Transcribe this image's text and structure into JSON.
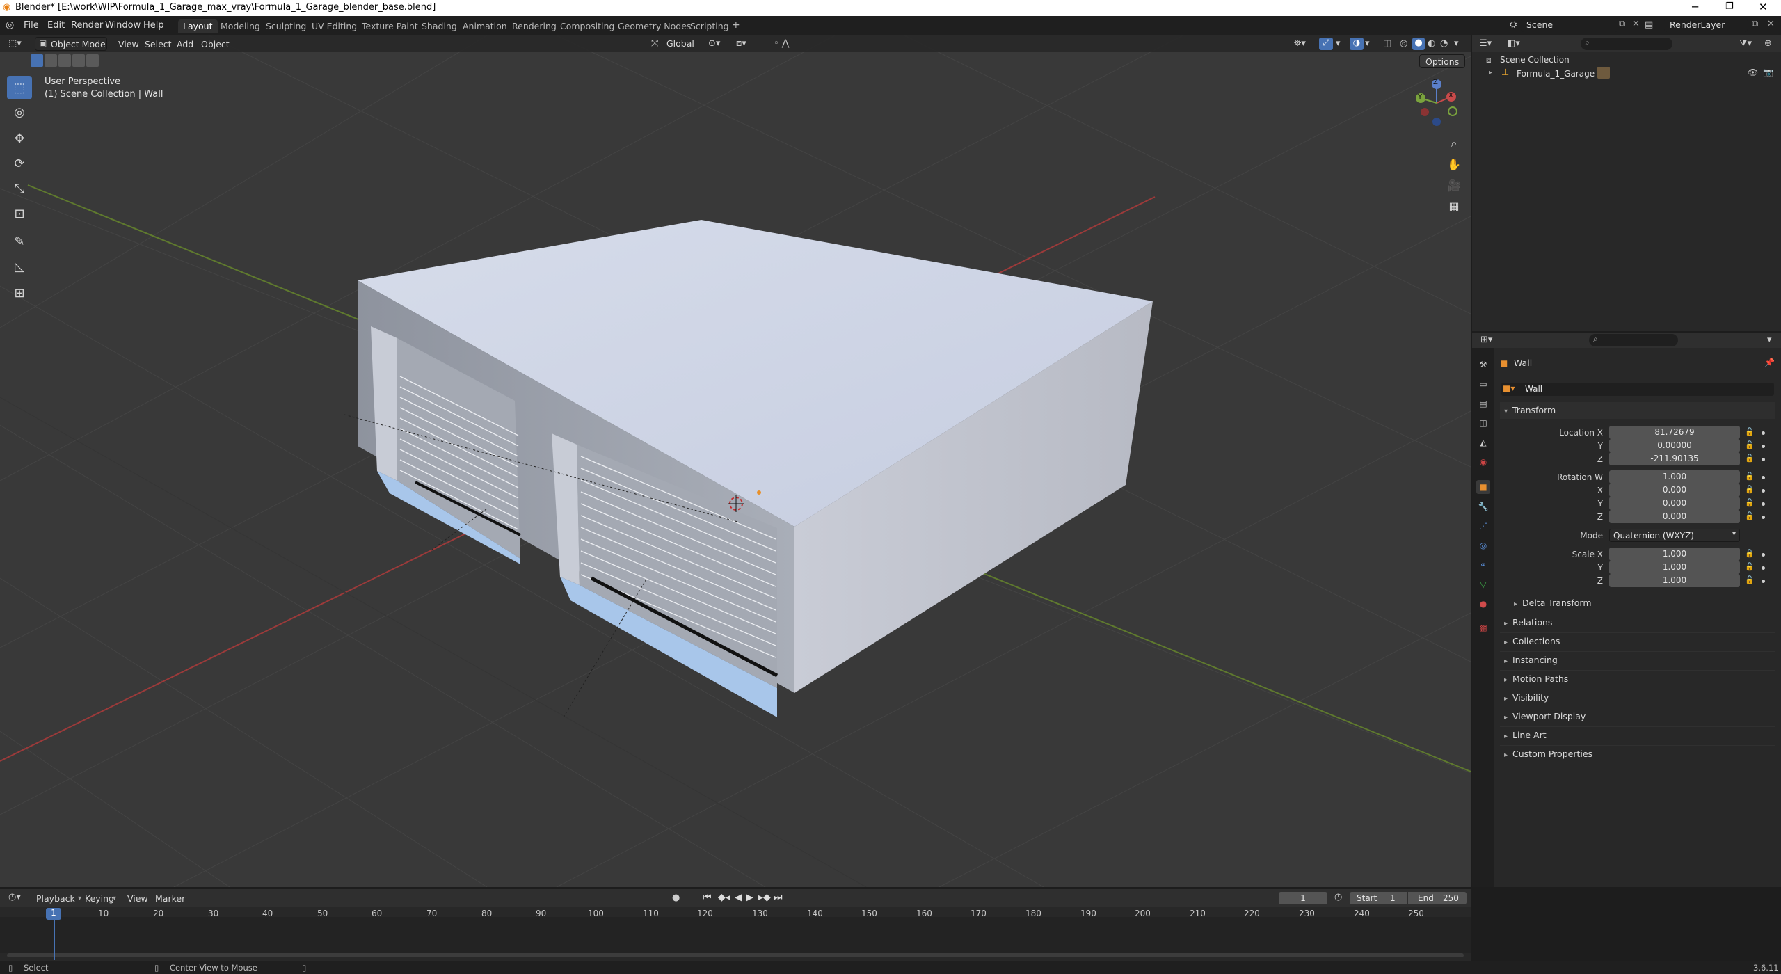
{
  "window": {
    "title": "Blender* [E:\\work\\WIP\\Formula_1_Garage_max_vray\\Formula_1_Garage_blender_base.blend]",
    "minimize": "─",
    "restore": "❐",
    "close": "✕"
  },
  "menu": [
    "File",
    "Edit",
    "Render",
    "Window",
    "Help"
  ],
  "workspaces": [
    "Layout",
    "Modeling",
    "Sculpting",
    "UV Editing",
    "Texture Paint",
    "Shading",
    "Animation",
    "Rendering",
    "Compositing",
    "Geometry Nodes",
    "Scripting"
  ],
  "add_workspace": "+",
  "scene": {
    "name": "Scene",
    "view_layer": "RenderLayer"
  },
  "viewport_header": {
    "mode": "Object Mode",
    "menus": [
      "View",
      "Select",
      "Add",
      "Object"
    ],
    "orientation": "Global",
    "options": "Options"
  },
  "viewport_overlay": {
    "perspective": "User Perspective",
    "collection": "(1) Scene Collection | Wall"
  },
  "gizmo_axes": {
    "x": "X",
    "y": "Y",
    "z": "Z"
  },
  "outliner": {
    "root": "Scene Collection",
    "items": [
      {
        "name": "Formula_1_Garage"
      }
    ]
  },
  "properties": {
    "object_name": "Wall",
    "data_name": "Wall",
    "transform_header": "Transform",
    "location_label": "Location X",
    "location": {
      "x": "81.72679",
      "y": "0.00000",
      "z": "-211.90135"
    },
    "rotation_label": "Rotation W",
    "rotation": {
      "w": "1.000",
      "x": "0.000",
      "y": "0.000",
      "z": "0.000"
    },
    "mode_label": "Mode",
    "mode_value": "Quaternion (WXYZ)",
    "scale_label": "Scale X",
    "scale": {
      "x": "1.000",
      "y": "1.000",
      "z": "1.000"
    },
    "axis_y": "Y",
    "axis_z": "Z",
    "axis_x": "X",
    "delta": "Delta Transform",
    "panels": [
      "Relations",
      "Collections",
      "Instancing",
      "Motion Paths",
      "Visibility",
      "Viewport Display",
      "Line Art",
      "Custom Properties"
    ]
  },
  "timeline": {
    "menus": [
      "Playback",
      "Keying",
      "View",
      "Marker"
    ],
    "current_frame": "1",
    "start_label": "Start",
    "start": "1",
    "end_label": "End",
    "end": "250",
    "ticks": [
      "1",
      "10",
      "20",
      "30",
      "40",
      "50",
      "60",
      "70",
      "80",
      "90",
      "100",
      "110",
      "120",
      "130",
      "140",
      "150",
      "160",
      "170",
      "180",
      "190",
      "200",
      "210",
      "220",
      "230",
      "240",
      "250"
    ]
  },
  "status": {
    "select": "Select",
    "center": "Center View to Mouse",
    "version": "3.6.11"
  }
}
